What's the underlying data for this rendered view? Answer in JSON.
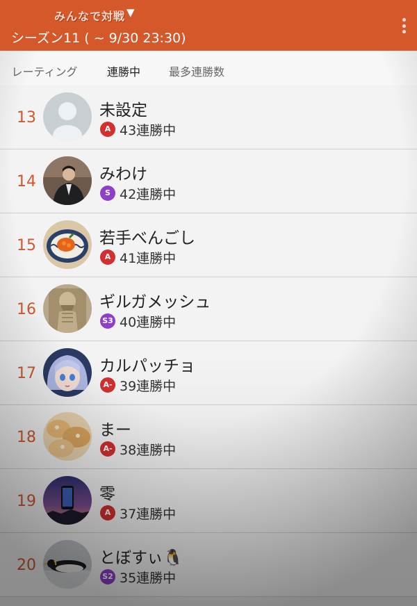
{
  "header": {
    "mode_title": "みんなで対戦",
    "season": "シーズン11 ( ~ 9/30 23:30)"
  },
  "tabs": [
    {
      "label": "レーティング"
    },
    {
      "label": "連勝中"
    },
    {
      "label": "最多連勝数"
    }
  ],
  "rows": [
    {
      "rank": "13",
      "name": "未設定",
      "badge": "A",
      "badge_color": "#d32f2f",
      "streak": "43連勝中",
      "avatar": "default-avatar"
    },
    {
      "rank": "14",
      "name": "みわけ",
      "badge": "S",
      "badge_color": "#8e3fc9",
      "streak": "42連勝中",
      "avatar": "person-photo"
    },
    {
      "rank": "15",
      "name": "若手べんごし",
      "badge": "A",
      "badge_color": "#d32f2f",
      "streak": "41連勝中",
      "avatar": "food-bowl-photo"
    },
    {
      "rank": "16",
      "name": "ギルガメッシュ",
      "badge": "S3",
      "badge_color": "#8e3fc9",
      "streak": "40連勝中",
      "avatar": "statue-photo"
    },
    {
      "rank": "17",
      "name": "カルパッチョ",
      "badge": "A-",
      "badge_color": "#d32f2f",
      "streak": "39連勝中",
      "avatar": "anime-character"
    },
    {
      "rank": "18",
      "name": "まー",
      "badge": "A-",
      "badge_color": "#d32f2f",
      "streak": "38連勝中",
      "avatar": "bread-photo"
    },
    {
      "rank": "19",
      "name": "零",
      "badge": "A",
      "badge_color": "#d32f2f",
      "streak": "37連勝中",
      "avatar": "phone-night-photo"
    },
    {
      "rank": "20",
      "name": "とぼすぃ🐧",
      "badge": "S2",
      "badge_color": "#8e3fc9",
      "streak": "35連勝中",
      "avatar": "penguin-photo"
    }
  ],
  "colors": {
    "accent": "#d4582a",
    "rank": "#cc5a2e"
  }
}
